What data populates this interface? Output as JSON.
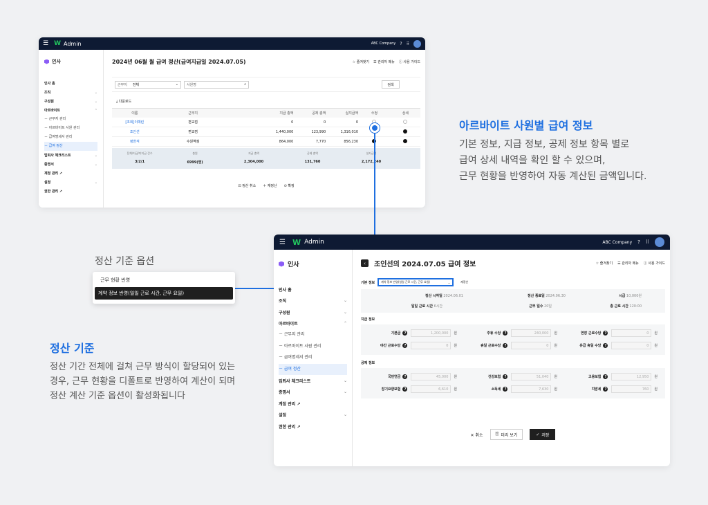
{
  "top_window": {
    "app_name": "Admin",
    "company": "ABC Company",
    "section": "인사",
    "title": "2024년 06월 월 급여 정산(급여지급일 2024.07.05)",
    "actions": {
      "favorite": "즐겨찾기",
      "admin_menu": "관리자 메뉴",
      "guide": "사용 가이드"
    },
    "sidebar": [
      {
        "label": "인사 홈",
        "chev": ""
      },
      {
        "label": "조직",
        "chev": "⌄"
      },
      {
        "label": "구성원",
        "chev": "⌄"
      },
      {
        "label": "아르바이트",
        "chev": "⌃"
      }
    ],
    "sub_items": [
      "－ 근무지 관리",
      "－ 아르바이트 사원 관리",
      "－ 급여명세서 관리",
      "－ 급여 정산"
    ],
    "sidebar_after": [
      {
        "label": "입퇴사 체크리스트",
        "chev": "⌄"
      },
      {
        "label": "증명서",
        "chev": "⌄"
      },
      {
        "label": "계정 관리 ↗",
        "chev": ""
      },
      {
        "label": "설정",
        "chev": "⌄"
      },
      {
        "label": "권한 관리 ↗",
        "chev": ""
      }
    ],
    "filter": {
      "label1": "근무지",
      "value1": "전체",
      "label2": "사원명",
      "search_btn": "검색"
    },
    "download": "다운로드",
    "table_headers": [
      "이름",
      "근무지",
      "지급 총액",
      "공제 총액",
      "실지급액",
      "수정",
      "상세"
    ],
    "rows": [
      {
        "name": "[조회]이예린",
        "place": "편교점",
        "pay": "0",
        "deduct": "0",
        "net": "0"
      },
      {
        "name": "조인선",
        "place": "편교점",
        "pay": "1,440,000",
        "deduct": "123,990",
        "net": "1,316,010"
      },
      {
        "name": "정한석",
        "place": "수원역점",
        "pay": "864,000",
        "deduct": "7,770",
        "net": "856,230"
      }
    ],
    "summary_headers": [
      "전체/지급/미지급 건수",
      "총원",
      "지급 총액",
      "공제 총액",
      "실지급액"
    ],
    "summary_values": [
      "3/2/1",
      "6999(명)",
      "2,304,000",
      "131,760",
      "2,172,240"
    ],
    "bottom_actions": [
      "정산 취소",
      "재정산",
      "확정"
    ]
  },
  "callout_right": {
    "title": "아르바이트 사원별 급여 정보",
    "lines": [
      "기본 정보, 지급 정보, 공제 정보 항목 별로",
      "급여 상세 내역을 확인 할 수 있으며,",
      "근무 현황을 반영하여 자동 계산된 금액입니다."
    ]
  },
  "option_box": {
    "caption": "정산 기준 옵션",
    "options": [
      "근무 현황 반영",
      "계약 정보 반영(일일 근로 시간, 근무 요일)"
    ]
  },
  "callout_left": {
    "title": "정산 기준",
    "lines": [
      "정산 기간 전체에 걸쳐 근무 방식이 할당되어 있는",
      "경우, 근무 현황을 디폴트로 반영하여 계산이 되며",
      "정산 계산 기준 옵션이 활성화됩니다"
    ]
  },
  "detail_window": {
    "app_name": "Admin",
    "company": "ABC Company",
    "section": "인사",
    "title": "조인선의 2024.07.05 급여 정보",
    "actions": {
      "favorite": "즐겨찾기",
      "admin_menu": "관리자 메뉴",
      "guide": "사용 가이드"
    },
    "sidebar": [
      {
        "label": "인사 홈",
        "chev": ""
      },
      {
        "label": "조직",
        "chev": "⌄"
      },
      {
        "label": "구성원",
        "chev": "⌄"
      },
      {
        "label": "아르바이트",
        "chev": "⌃"
      }
    ],
    "sub_items": [
      "－ 근무지 관리",
      "－ 아르바이트 사원 관리",
      "－ 급여명세서 관리",
      "－ 급여 정산"
    ],
    "sidebar_after": [
      {
        "label": "입퇴사 체크리스트",
        "chev": "⌄"
      },
      {
        "label": "증명서",
        "chev": "⌄"
      },
      {
        "label": "계정 관리 ↗",
        "chev": ""
      },
      {
        "label": "설정",
        "chev": "⌄"
      },
      {
        "label": "권한 관리 ↗",
        "chev": ""
      }
    ],
    "basic_label": "기본 정보",
    "basis_select": "계약 정보 반영(일일 근로 시간, 근무 요일)",
    "recalc": "재정산",
    "basic": {
      "start_label": "정산 시작일",
      "start": "2024.06.01",
      "end_label": "정산 종료일",
      "end": "2024.06.30",
      "wage_label": "시급",
      "wage": "10,000원",
      "daily_label": "일일 근로 시간",
      "daily": "6시간",
      "days_label": "근무 일수",
      "days": "20일",
      "total_label": "총 근로 시간",
      "total": "120:00"
    },
    "pay_label": "지급 정보",
    "pay": [
      {
        "label": "기본급",
        "value": "1,200,000"
      },
      {
        "label": "주휴 수당",
        "value": "240,000"
      },
      {
        "label": "연장 근로수당",
        "value": "0"
      },
      {
        "label": "야간 근로수당",
        "value": "0"
      },
      {
        "label": "휴일 근로수당",
        "value": "0"
      },
      {
        "label": "유급 휴일 수당",
        "value": "0"
      }
    ],
    "deduct_label": "공제 정보",
    "deduct": [
      {
        "label": "국민연금",
        "value": "45,000"
      },
      {
        "label": "건강보험",
        "value": "51,040"
      },
      {
        "label": "고용보험",
        "value": "12,950"
      },
      {
        "label": "장기요양보험",
        "value": "6,610"
      },
      {
        "label": "소득세",
        "value": "7,630"
      },
      {
        "label": "지방세",
        "value": "760"
      }
    ],
    "unit": "원",
    "buttons": {
      "cancel": "취소",
      "preview": "미리 보기",
      "save": "저장"
    }
  }
}
